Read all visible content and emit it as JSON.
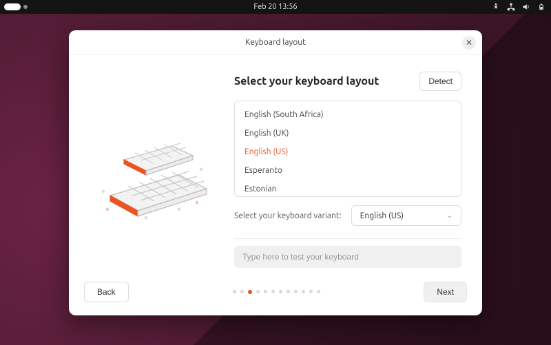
{
  "topbar": {
    "datetime": "Feb 20  13:56"
  },
  "dialog": {
    "title": "Keyboard layout",
    "heading": "Select your keyboard layout",
    "detect_label": "Detect",
    "layouts": [
      "English (South Africa)",
      "English (UK)",
      "English (US)",
      "Esperanto",
      "Estonian"
    ],
    "selected_layout_index": 2,
    "variant_label": "Select your keyboard variant:",
    "variant_value": "English (US)",
    "test_placeholder": "Type here to test your keyboard",
    "back_label": "Back",
    "next_label": "Next",
    "pager": {
      "count": 12,
      "active": 2
    }
  },
  "colors": {
    "accent": "#e95420"
  }
}
